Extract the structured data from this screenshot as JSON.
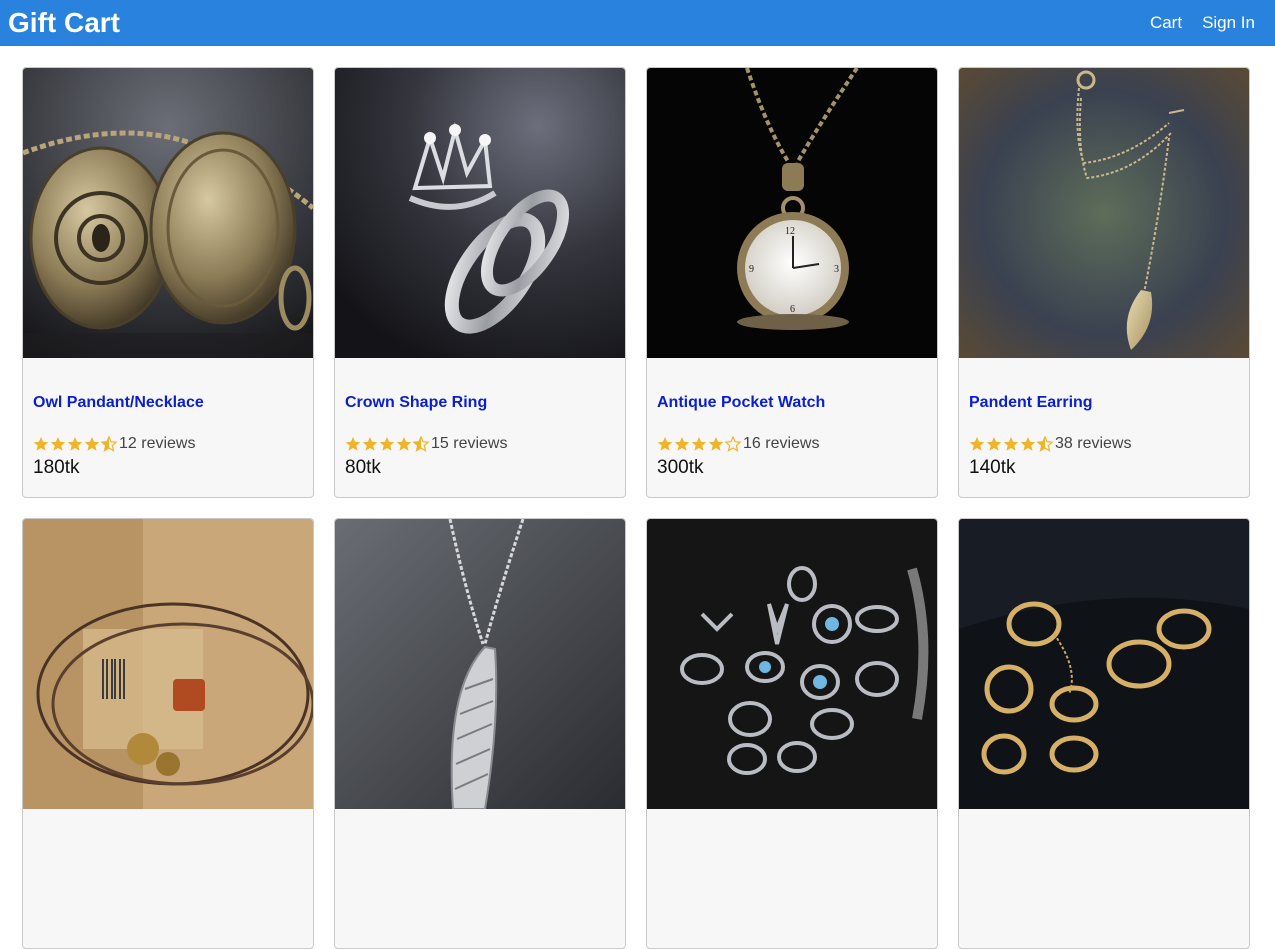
{
  "header": {
    "brand": "Gift Cart",
    "nav": [
      {
        "label": "Cart"
      },
      {
        "label": "Sign In"
      }
    ]
  },
  "colors": {
    "header_bg": "#2982dd",
    "link": "#0a1fd0",
    "star": "#f0b429"
  },
  "products": [
    {
      "title": "Owl Pandant/Necklace",
      "rating": 4.5,
      "reviews": "12 reviews",
      "price": "180tk",
      "image": "locket-image"
    },
    {
      "title": "Crown Shape Ring",
      "rating": 4.5,
      "reviews": "15 reviews",
      "price": "80tk",
      "image": "crown-ring-image"
    },
    {
      "title": "Antique Pocket Watch",
      "rating": 4,
      "reviews": "16 reviews",
      "price": "300tk",
      "image": "pocket-watch-image"
    },
    {
      "title": "Pandent Earring",
      "rating": 4.5,
      "reviews": "38 reviews",
      "price": "140tk",
      "image": "leaf-earring-image"
    },
    {
      "title": "",
      "rating": 0,
      "reviews": "",
      "price": "",
      "image": "cord-bracelet-image"
    },
    {
      "title": "",
      "rating": 0,
      "reviews": "",
      "price": "",
      "image": "wing-necklace-image"
    },
    {
      "title": "",
      "rating": 0,
      "reviews": "",
      "price": "",
      "image": "ring-set-image"
    },
    {
      "title": "",
      "rating": 0,
      "reviews": "",
      "price": "",
      "image": "gold-rings-image"
    }
  ]
}
